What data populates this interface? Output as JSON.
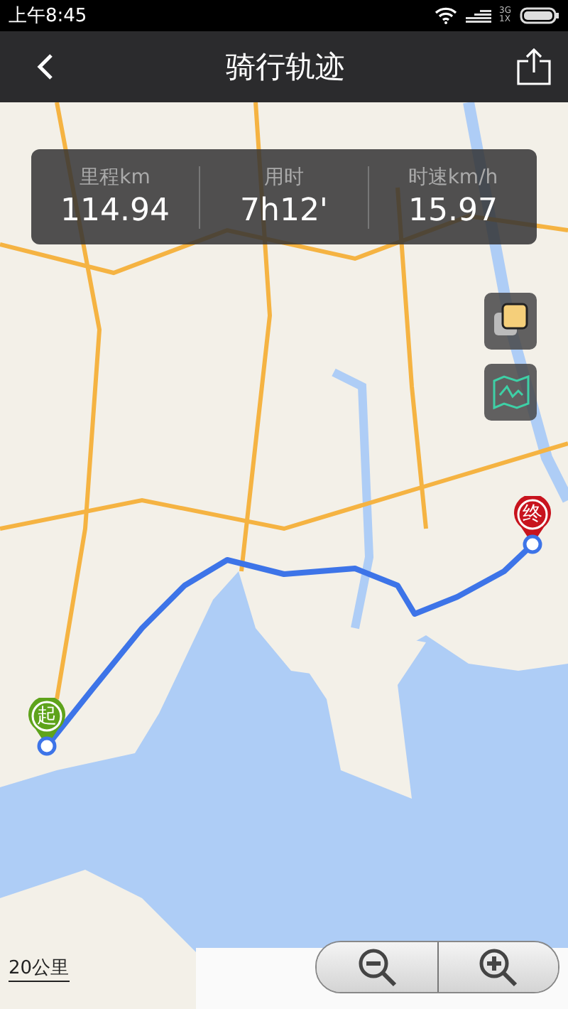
{
  "status_bar": {
    "time": "上午8:45",
    "network": "3G",
    "network_sub": "1X"
  },
  "app_bar": {
    "title": "骑行轨迹"
  },
  "stats": [
    {
      "label": "里程km",
      "value": "114.94"
    },
    {
      "label": "用时",
      "value": "7h12'"
    },
    {
      "label": "时速km/h",
      "value": "15.97"
    }
  ],
  "map": {
    "markers": [
      {
        "kind": "start",
        "label": "起"
      },
      {
        "kind": "end",
        "label": "终"
      }
    ],
    "scale": "20公里"
  }
}
